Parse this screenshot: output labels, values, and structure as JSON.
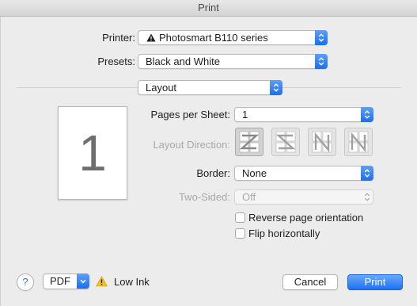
{
  "window": {
    "title": "Print"
  },
  "printer": {
    "label": "Printer:",
    "value": "Photosmart B110 series"
  },
  "presets": {
    "label": "Presets:",
    "value": "Black and White"
  },
  "section": {
    "value": "Layout"
  },
  "preview": {
    "page_number": "1"
  },
  "pages_per_sheet": {
    "label": "Pages per Sheet:",
    "value": "1"
  },
  "layout_direction": {
    "label": "Layout Direction:"
  },
  "border": {
    "label": "Border:",
    "value": "None"
  },
  "two_sided": {
    "label": "Two-Sided:",
    "value": "Off"
  },
  "options": {
    "reverse": "Reverse page orientation",
    "flip": "Flip horizontally"
  },
  "footer": {
    "help": "?",
    "pdf": "PDF",
    "status": "Low Ink",
    "cancel": "Cancel",
    "print": "Print"
  },
  "colors": {
    "accent": "#1d72f3",
    "disabled": "#a8a8a8"
  }
}
